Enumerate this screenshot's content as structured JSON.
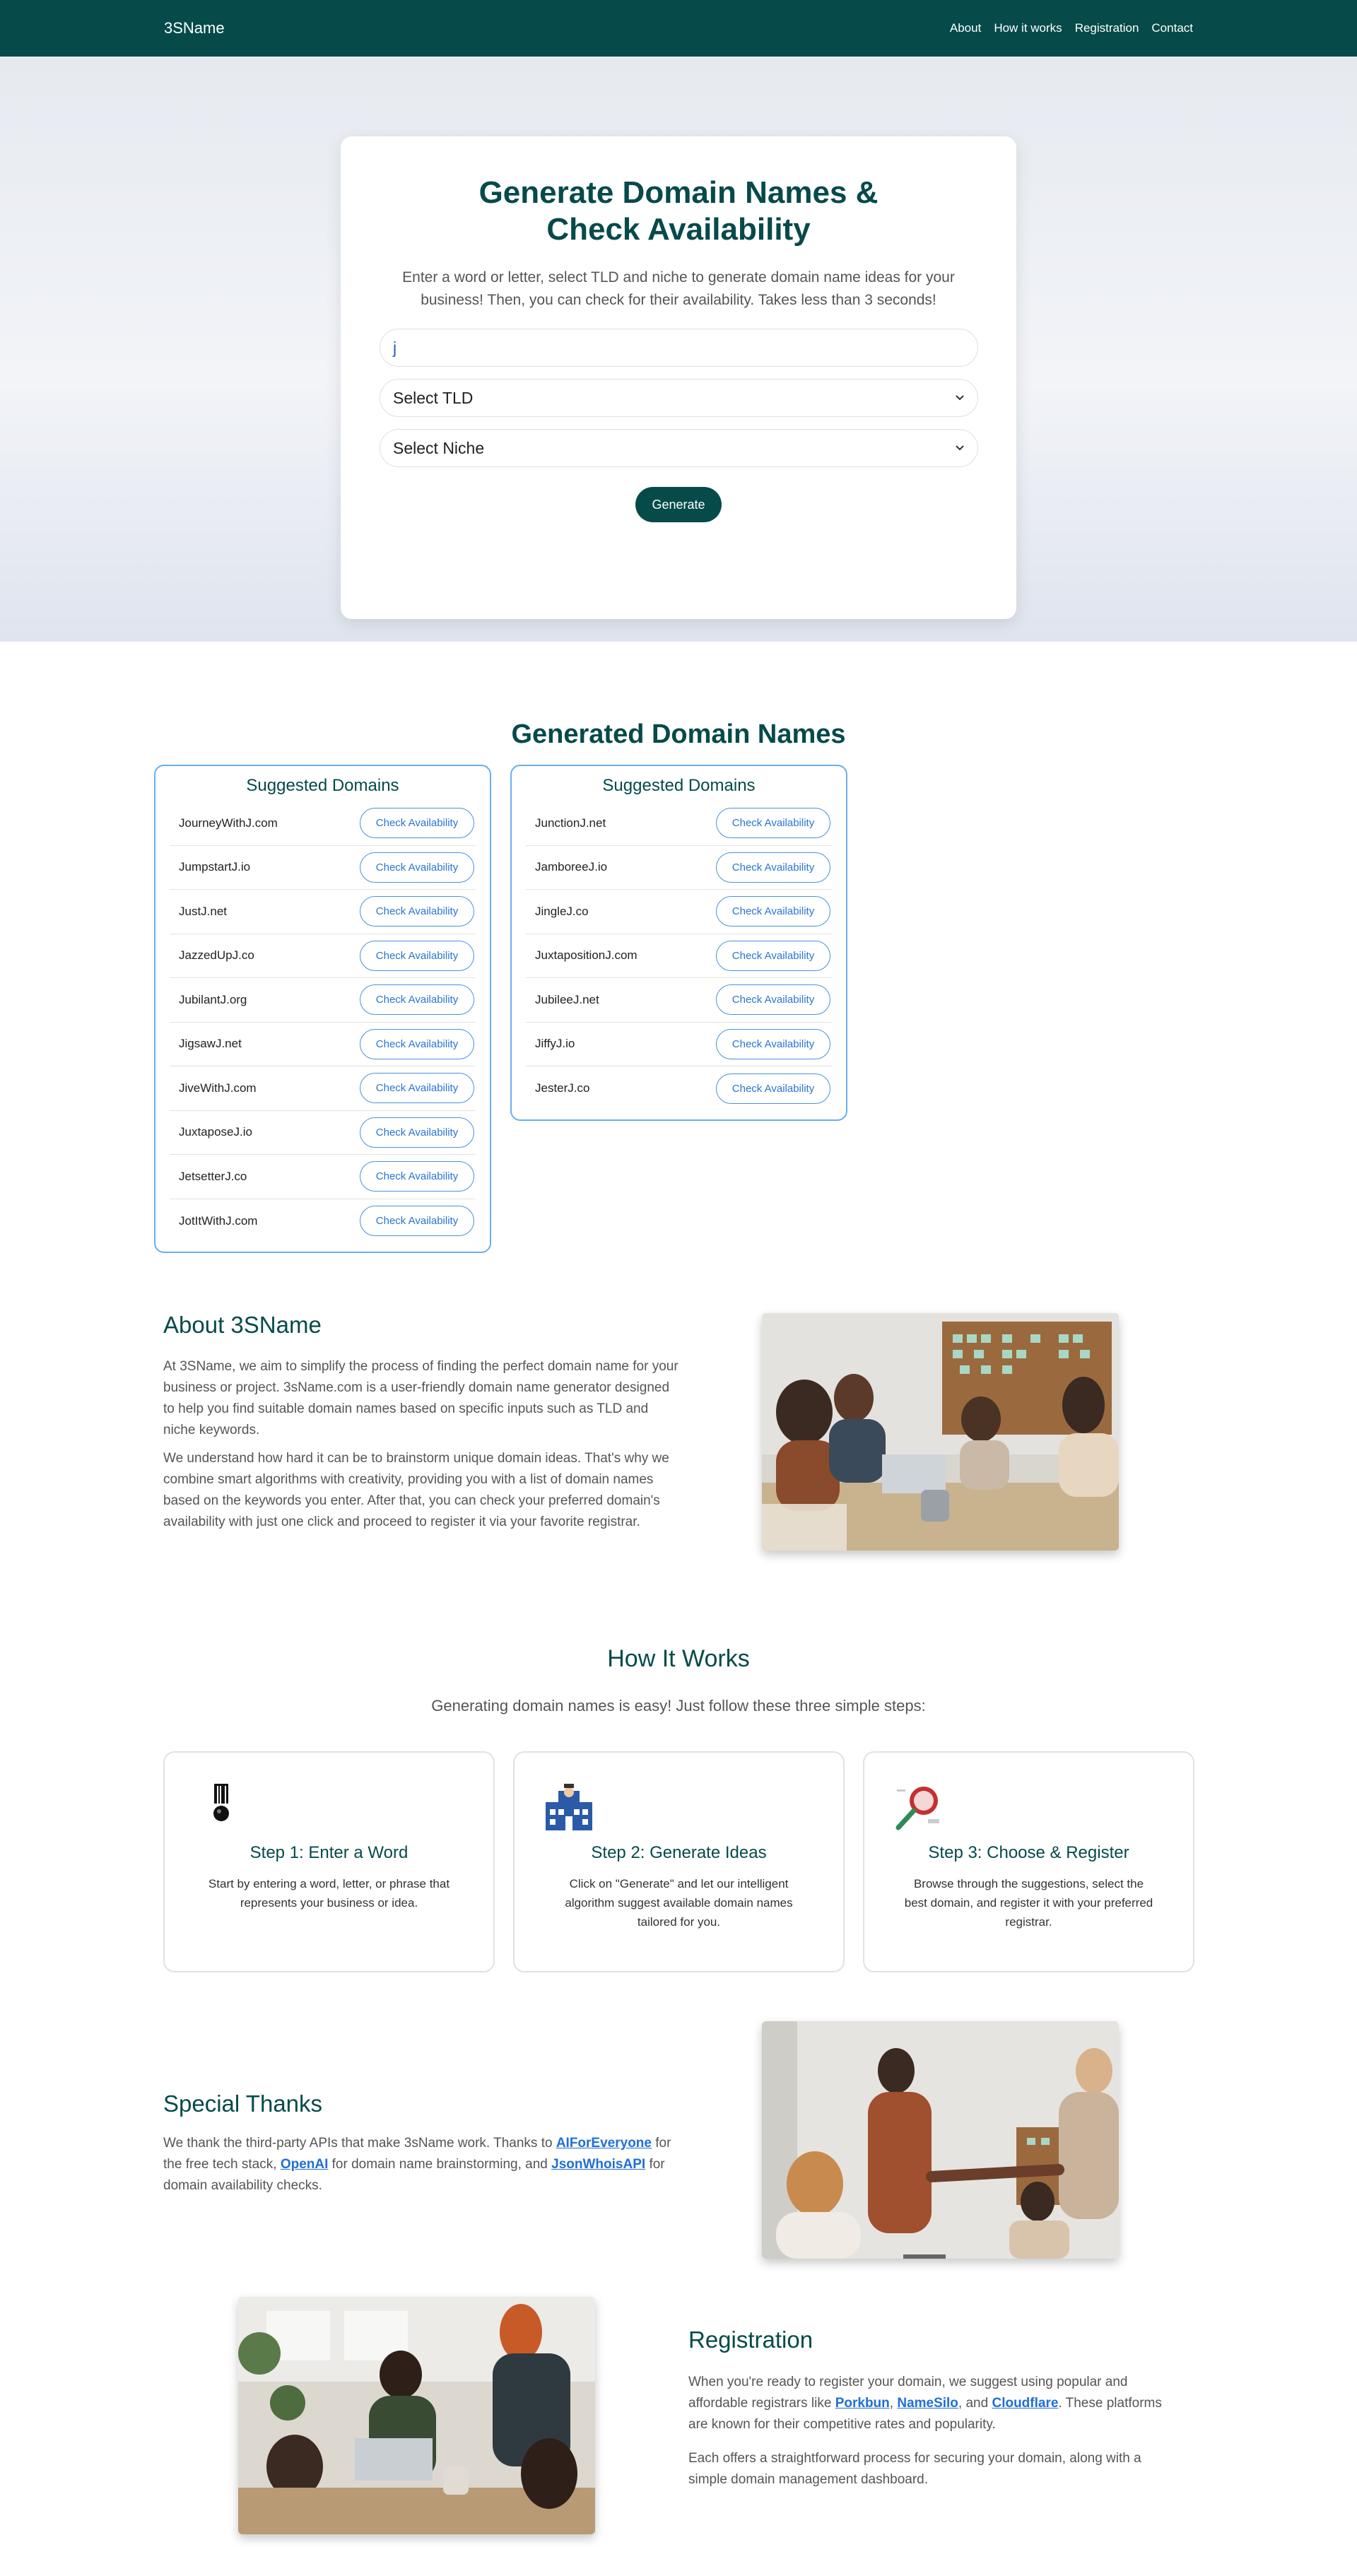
{
  "nav": {
    "brand": "3SName",
    "links": [
      "About",
      "How it works",
      "Registration",
      "Contact"
    ]
  },
  "hero": {
    "title": "Generate Domain Names & Check Availability",
    "description": "Enter a word or letter, select TLD and niche to generate domain name ideas for your business! Then, you can check for their availability. Takes less than 3 seconds!",
    "word_value": "j",
    "tld_placeholder": "Select TLD",
    "niche_placeholder": "Select Niche",
    "generate_label": "Generate"
  },
  "generated": {
    "heading": "Generated Domain Names",
    "check_label": "Check Availability",
    "columns": [
      {
        "title": "Suggested Domains",
        "domains": [
          "JourneyWithJ.com",
          "JumpstartJ.io",
          "JustJ.net",
          "JazzedUpJ.co",
          "JubilantJ.org",
          "JigsawJ.net",
          "JiveWithJ.com",
          "JuxtaposeJ.io",
          "JetsetterJ.co",
          "JotItWithJ.com"
        ]
      },
      {
        "title": "Suggested Domains",
        "domains": [
          "JunctionJ.net",
          "JamboreeJ.io",
          "JingleJ.co",
          "JuxtapositionJ.com",
          "JubileeJ.net",
          "JiffyJ.io",
          "JesterJ.co"
        ]
      }
    ]
  },
  "about": {
    "title": "About 3SName",
    "p1": "At 3SName, we aim to simplify the process of finding the perfect domain name for your business or project. 3sName.com is a user-friendly domain name generator designed to help you find suitable domain names based on specific inputs such as TLD and niche keywords.",
    "p2": "We understand how hard it can be to brainstorm unique domain ideas. That's why we combine smart algorithms with creativity, providing you with a list of domain names based on the keywords you enter. After that, you can check your preferred domain's availability with just one click and proceed to register it via your favorite registrar."
  },
  "how": {
    "title": "How It Works",
    "subtitle": "Generating domain names is easy! Just follow these three simple steps:",
    "steps": [
      {
        "title": "Step 1: Enter a Word",
        "text": "Start by entering a word, letter, or phrase that represents your business or idea.",
        "icon": "barcode-badge-icon"
      },
      {
        "title": "Step 2: Generate Ideas",
        "text": "Click on \"Generate\" and let our intelligent algorithm suggest available domain names tailored for you.",
        "icon": "building-icon"
      },
      {
        "title": "Step 3: Choose & Register",
        "text": "Browse through the suggestions, select the best domain, and register it with your preferred registrar.",
        "icon": "magnifier-icon"
      }
    ]
  },
  "thanks": {
    "title": "Special Thanks",
    "text_1": "We thank the third-party APIs that make 3sName work. Thanks to ",
    "link_1": "AIForEveryone",
    "text_2": " for the free tech stack, ",
    "link_2": "OpenAI",
    "text_3": " for domain name brainstorming, and ",
    "link_3": "JsonWhoisAPI",
    "text_4": " for domain availability checks."
  },
  "registration": {
    "title": "Registration",
    "text_1": "When you're ready to register your domain, we suggest using popular and affordable registrars like ",
    "link_1": "Porkbun",
    "sep_1": ", ",
    "link_2": "NameSilo",
    "sep_2": ", and ",
    "link_3": "Cloudflare",
    "text_2": ". These platforms are known for their competitive rates and popularity.",
    "p2": "Each offers a straightforward process for securing your domain, along with a simple domain management dashboard."
  },
  "colors": {
    "primary": "#064a4a",
    "card_border": "#6aaef0",
    "link": "#1f6fd6"
  }
}
